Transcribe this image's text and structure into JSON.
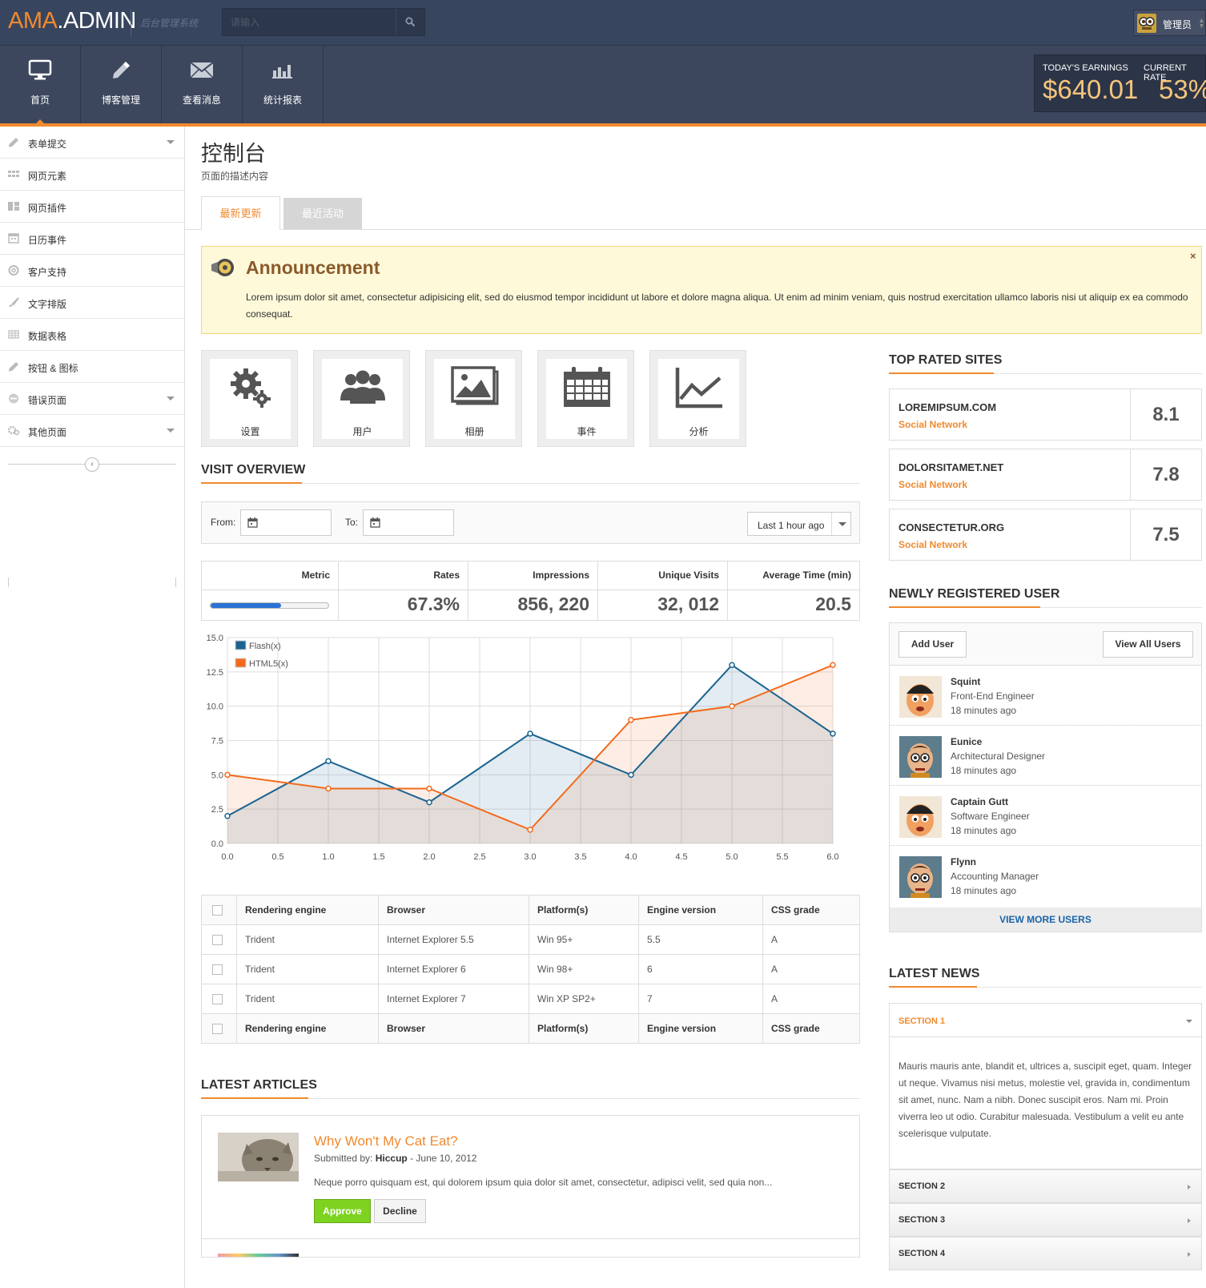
{
  "app": {
    "logo_prefix": "AMA",
    "logo_suffix": ".ADMIN",
    "subtitle": "后台管理系统",
    "search_placeholder": "请输入",
    "user_name": "管理员"
  },
  "nav": {
    "items": [
      {
        "label": "首页",
        "icon": "monitor-icon",
        "active": true
      },
      {
        "label": "博客管理",
        "icon": "pencil-icon"
      },
      {
        "label": "查看消息",
        "icon": "envelope-icon"
      },
      {
        "label": "统计报表",
        "icon": "bar-chart-icon"
      }
    ]
  },
  "stats": {
    "earnings_label": "TODAY'S EARNINGS",
    "earnings_value": "$640.01",
    "rate_label": "CURRENT RATE",
    "rate_value": "53%"
  },
  "sidebar": {
    "items": [
      {
        "label": "表单提交",
        "icon": "pencil-icon",
        "caret": true
      },
      {
        "label": "网页元素",
        "icon": "grid-icon"
      },
      {
        "label": "网页插件",
        "icon": "widgets-icon"
      },
      {
        "label": "日历事件",
        "icon": "calendar-icon"
      },
      {
        "label": "客户支持",
        "icon": "lifebuoy-icon"
      },
      {
        "label": "文字排版",
        "icon": "brush-icon"
      },
      {
        "label": "数据表格",
        "icon": "table-icon"
      },
      {
        "label": "按钮 & 图标",
        "icon": "pencil-icon"
      },
      {
        "label": "错误页面",
        "icon": "minus-circle-icon",
        "caret": true
      },
      {
        "label": "其他页面",
        "icon": "gears-icon",
        "caret": true
      }
    ]
  },
  "page": {
    "title": "控制台",
    "description": "页面的描述内容",
    "tabs": [
      "最新更新",
      "最近活动"
    ]
  },
  "announcement": {
    "title": "Announcement",
    "text": "Lorem ipsum dolor sit amet, consectetur adipisicing elit, sed do eiusmod tempor incididunt ut labore et dolore magna aliqua. Ut enim ad minim veniam, quis nostrud exercitation ullamco laboris nisi ut aliquip ex ea commodo consequat.",
    "close": "×"
  },
  "tiles": [
    {
      "label": "设置",
      "icon": "gears-icon"
    },
    {
      "label": "用户",
      "icon": "users-icon"
    },
    {
      "label": "相册",
      "icon": "photo-icon"
    },
    {
      "label": "事件",
      "icon": "calendar-icon"
    },
    {
      "label": "分析",
      "icon": "line-chart-icon"
    }
  ],
  "visit": {
    "title": "VISIT OVERVIEW",
    "from_label": "From:",
    "to_label": "To:",
    "range": "Last 1 hour ago",
    "metrics": {
      "headers": [
        "Metric",
        "Rates",
        "Impressions",
        "Unique Visits",
        "Average Time (min)"
      ],
      "values": [
        "67.3%",
        "856, 220",
        "32, 012",
        "20.5"
      ],
      "progress": 0.6
    }
  },
  "chart_data": {
    "type": "area",
    "xlim": [
      0,
      6
    ],
    "ylim": [
      0,
      15
    ],
    "x_ticks": [
      "0.0",
      "0.5",
      "1.0",
      "1.5",
      "2.0",
      "2.5",
      "3.0",
      "3.5",
      "4.0",
      "4.5",
      "5.0",
      "5.5",
      "6.0"
    ],
    "y_ticks": [
      "0.0",
      "2.5",
      "5.0",
      "7.5",
      "10.0",
      "12.5",
      "15.0"
    ],
    "grid": true,
    "legend_position": "top-left",
    "series": [
      {
        "name": "Flash(x)",
        "color": "#1b6490",
        "x": [
          0,
          1,
          2,
          3,
          4,
          5,
          6
        ],
        "y": [
          2,
          6,
          3,
          8,
          5,
          13,
          8
        ]
      },
      {
        "name": "HTML5(x)",
        "color": "#f26b1d",
        "x": [
          0,
          1,
          2,
          3,
          4,
          5,
          6
        ],
        "y": [
          5,
          4,
          4,
          1,
          9,
          10,
          13
        ]
      }
    ]
  },
  "table": {
    "headers": [
      "Rendering engine",
      "Browser",
      "Platform(s)",
      "Engine version",
      "CSS grade"
    ],
    "rows": [
      [
        "Trident",
        "Internet Explorer 5.5",
        "Win 95+",
        "5.5",
        "A"
      ],
      [
        "Trident",
        "Internet Explorer 6",
        "Win 98+",
        "6",
        "A"
      ],
      [
        "Trident",
        "Internet Explorer 7",
        "Win XP SP2+",
        "7",
        "A"
      ]
    ]
  },
  "articles": {
    "title": "LATEST ARTICLES",
    "items": [
      {
        "title": "Why Won't My Cat Eat?",
        "submitted_prefix": "Submitted by: ",
        "author": "Hiccup",
        "date": " - June 10, 2012",
        "text": "Neque porro quisquam est, qui dolorem ipsum quia dolor sit amet, consectetur, adipisci velit, sed quia non...",
        "approve": "Approve",
        "decline": "Decline"
      }
    ]
  },
  "top_sites": {
    "title": "TOP RATED SITES",
    "items": [
      {
        "name": "LOREMIPSUM.COM",
        "category": "Social Network",
        "score": "8.1"
      },
      {
        "name": "DOLORSITAMET.NET",
        "category": "Social Network",
        "score": "7.8"
      },
      {
        "name": "CONSECTETUR.ORG",
        "category": "Social Network",
        "score": "7.5"
      }
    ]
  },
  "new_users": {
    "title": "NEWLY REGISTERED USER",
    "add": "Add User",
    "view_all": "View All Users",
    "more": "VIEW MORE USERS",
    "items": [
      {
        "name": "Squint",
        "role": "Front-End Engineer",
        "time": "18 minutes ago"
      },
      {
        "name": "Eunice",
        "role": "Architectural Designer",
        "time": "18 minutes ago"
      },
      {
        "name": "Captain Gutt",
        "role": "Software Engineer",
        "time": "18 minutes ago"
      },
      {
        "name": "Flynn",
        "role": "Accounting Manager",
        "time": "18 minutes ago"
      }
    ]
  },
  "news": {
    "title": "LATEST NEWS",
    "sections": [
      "SECTION 1",
      "SECTION 2",
      "SECTION 3",
      "SECTION 4"
    ],
    "text": "Mauris mauris ante, blandit et, ultrices a, suscipit eget, quam. Integer ut neque. Vivamus nisi metus, molestie vel, gravida in, condimentum sit amet, nunc. Nam a nibh. Donec suscipit eros. Nam mi. Proin viverra leo ut odio. Curabitur malesuada. Vestibulum a velit eu ante scelerisque vulputate."
  },
  "colors": {
    "accent": "#f08a2e",
    "header": "#38455f",
    "link": "#1a64a8"
  }
}
